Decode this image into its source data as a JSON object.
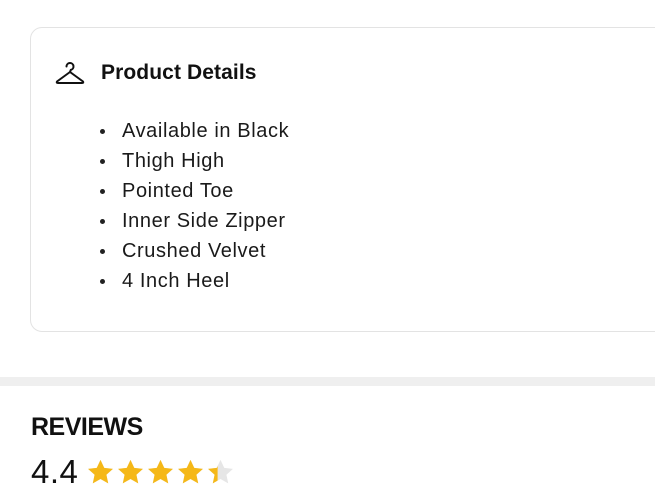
{
  "product_details": {
    "icon": "hanger-icon",
    "title": "Product Details",
    "items": [
      "Available in Black",
      "Thigh High",
      "Pointed Toe",
      "Inner Side Zipper",
      "Crushed Velvet",
      "4 Inch Heel"
    ]
  },
  "reviews": {
    "heading": "REVIEWS",
    "rating": "4.4",
    "rating_value": 4.4,
    "max_stars": 5,
    "star_color": "#F5B818",
    "empty_star_color": "#E6E6E6"
  }
}
